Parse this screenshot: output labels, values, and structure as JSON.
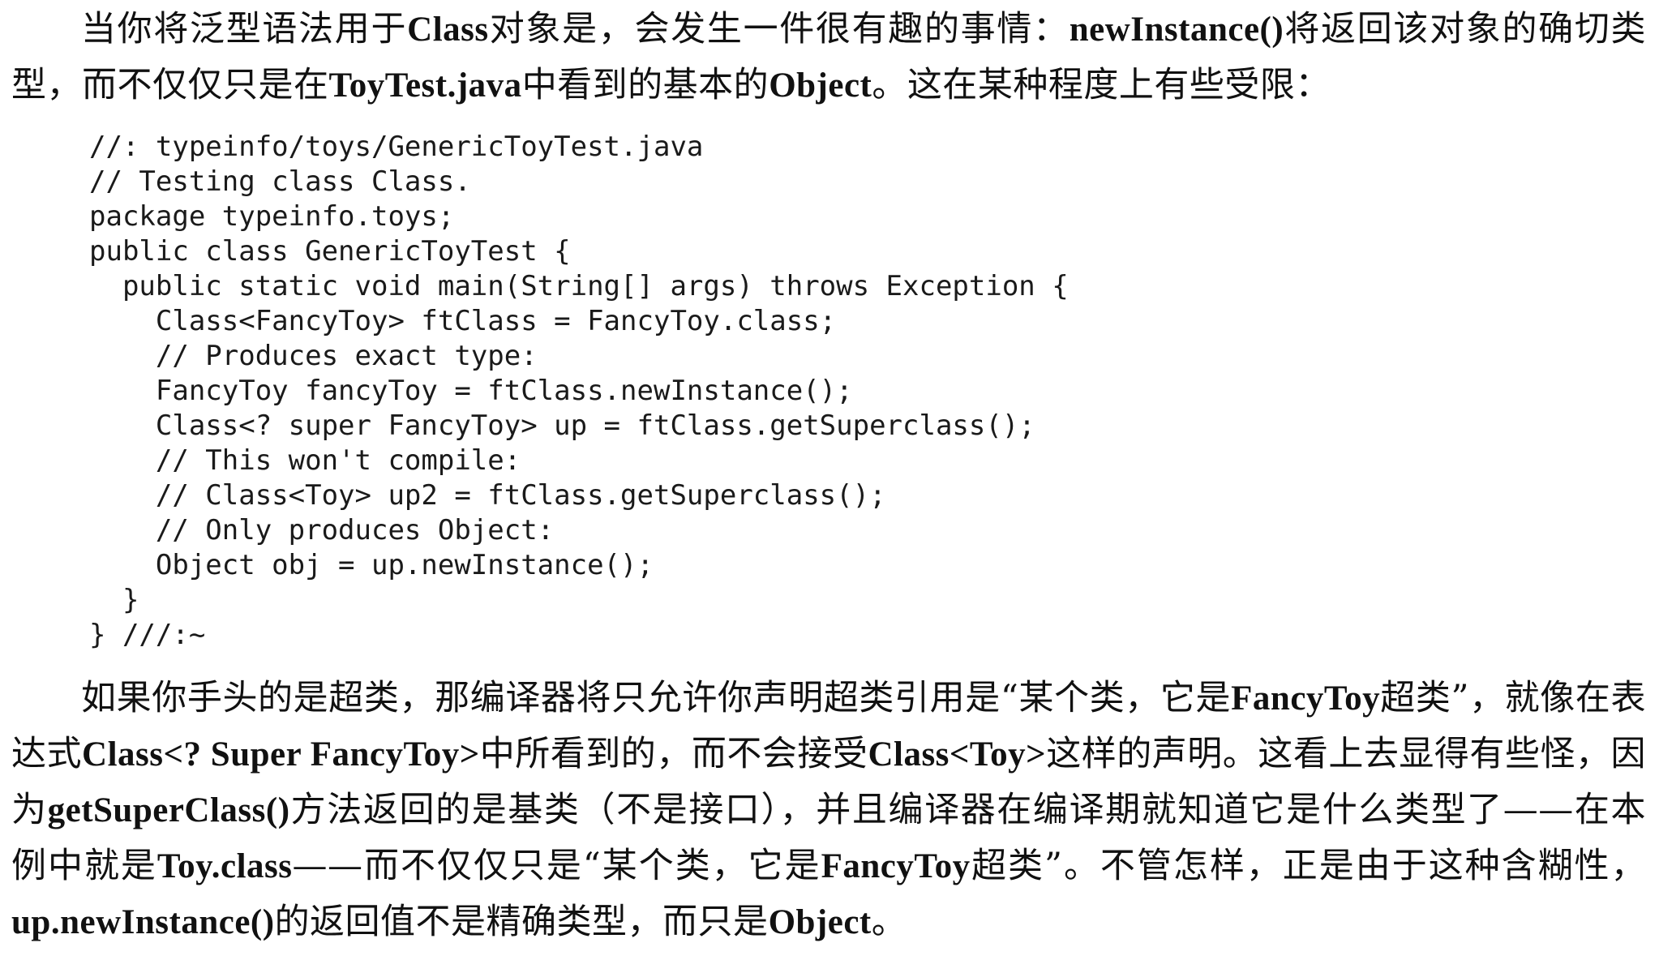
{
  "intro": {
    "p1_text1": "当你将泛型语法用于",
    "p1_b1": "Class",
    "p1_text2": "对象是，会发生一件很有趣的事情：",
    "p1_b2": "newInstance()",
    "p1_text3": "将返回该对象的确切类型，而不仅仅只是在",
    "p1_b3": "ToyTest.java",
    "p1_text4": "中看到的基本的",
    "p1_b4": "Object",
    "p1_text5": "。这在某种程度上有些受限："
  },
  "code_lines": [
    "//: typeinfo/toys/GenericToyTest.java",
    "// Testing class Class.",
    "package typeinfo.toys;",
    "public class GenericToyTest {",
    "  public static void main(String[] args) throws Exception {",
    "    Class<FancyToy> ftClass = FancyToy.class;",
    "    // Produces exact type:",
    "    FancyToy fancyToy = ftClass.newInstance();",
    "    Class<? super FancyToy> up = ftClass.getSuperclass();",
    "    // This won't compile:",
    "    // Class<Toy> up2 = ftClass.getSuperclass();",
    "    // Only produces Object:",
    "    Object obj = up.newInstance();",
    "  }",
    "} ///:~"
  ],
  "explanation": {
    "t1": "如果你手头的是超类，那编译器将只允许你声明超类引用是“某个类，它是",
    "b1": "FancyToy",
    "t2": "超类”，就像在表达式",
    "b2": "Class<? Super FancyToy>",
    "t3": "中所看到的，而不会接受",
    "b3": "Class<Toy>",
    "t4": "这样的声明。这看上去显得有些怪，因为",
    "b4": "getSuperClass()",
    "t5": "方法返回的是基类（不是接口），并且编译器在编译期就知道它是什么类型了——在本例中就是",
    "b5": "Toy.class",
    "t6": "——而不仅仅只是“某个类，它是",
    "b6": "FancyToy",
    "t7": "超类”。不管怎样，正是由于这种含糊性，",
    "b7": "up.newInstance()",
    "t8": "的返回值不是精确类型，而只是",
    "b8": "Object",
    "t9": "。"
  }
}
